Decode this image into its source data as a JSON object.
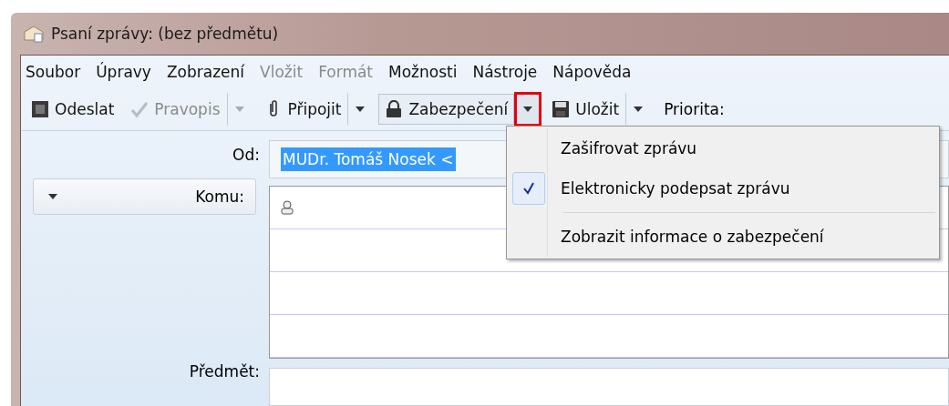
{
  "window": {
    "title": "Psaní zprávy: (bez předmětu)"
  },
  "menu_bar": [
    {
      "label": "Soubor",
      "disabled": false
    },
    {
      "label": "Úpravy",
      "disabled": false
    },
    {
      "label": "Zobrazení",
      "disabled": false
    },
    {
      "label": "Vložit",
      "disabled": true
    },
    {
      "label": "Formát",
      "disabled": true
    },
    {
      "label": "Možnosti",
      "disabled": false
    },
    {
      "label": "Nástroje",
      "disabled": false
    },
    {
      "label": "Nápověda",
      "disabled": false
    }
  ],
  "toolbar": [
    {
      "kind": "send",
      "label": "Odeslat",
      "disabled": false,
      "pressed": false
    },
    {
      "kind": "spell",
      "label": "Pravopis",
      "disabled": true,
      "pressed": false,
      "dropdown": {
        "highlighted": false
      }
    },
    {
      "kind": "attach",
      "label": "Připojit",
      "disabled": false,
      "pressed": false,
      "dropdown": {
        "highlighted": false
      }
    },
    {
      "kind": "lock",
      "label": "Zabezpečení",
      "disabled": false,
      "pressed": true,
      "dropdown": {
        "highlighted": true
      }
    },
    {
      "kind": "save",
      "label": "Uložit",
      "disabled": false,
      "pressed": false,
      "dropdown": {
        "highlighted": false
      }
    },
    {
      "kind": "text",
      "label": "Priorita:"
    }
  ],
  "header": {
    "from_label": "Od:",
    "from_value": "MUDr. Tomáš Nosek <",
    "from_selected": true,
    "to_label": "Komu:",
    "subject_label": "Předmět:"
  },
  "security_menu": [
    {
      "kind": "item",
      "label": "Zašifrovat zprávu",
      "checked": false
    },
    {
      "kind": "item",
      "label": "Elektronicky podepsat zprávu",
      "checked": true
    },
    {
      "kind": "separator"
    },
    {
      "kind": "item",
      "label": "Zobrazit informace o zabezpečení",
      "checked": false
    }
  ]
}
